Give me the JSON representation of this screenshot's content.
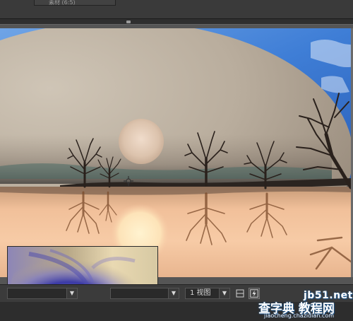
{
  "header": {
    "tab_label": "素材 (6:5)"
  },
  "toolbar": {
    "resolution_value": "",
    "view_select_value": "",
    "view_count_label": "1 视图"
  },
  "watermark": {
    "site": "jb51.net",
    "cn": "查字典 教程网",
    "url": "jiaocheng.chazidian.com"
  },
  "icons": {
    "cursor": "crosshair-cursor-icon",
    "dropdown": "chevron-down-icon",
    "grid": "grid-icon",
    "snapshot": "snapshot-icon"
  },
  "colors": {
    "app_bg": "#2f2f2f",
    "toolbar_bg": "#3b3b3b",
    "sky_blue": "#3f7ed6",
    "sunset_orange": "#f7c39a"
  }
}
